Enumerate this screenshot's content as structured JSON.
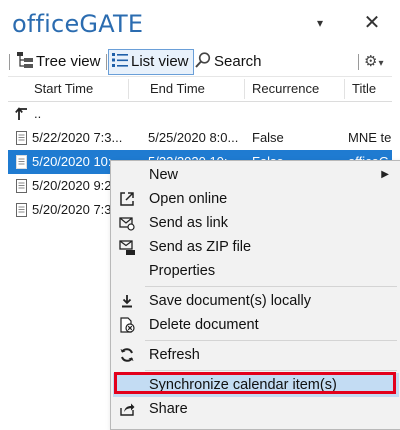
{
  "app": {
    "title": "officeGATE",
    "dropdown_glyph": "▾",
    "close_glyph": "✕"
  },
  "toolbar": {
    "tree_view": "Tree view",
    "list_view": "List view",
    "search": "Search",
    "settings_glyph": "⚙",
    "settings_arrow": "▾"
  },
  "columns": [
    "Start Time",
    "End Time",
    "Recurrence",
    "Title"
  ],
  "rows": [
    {
      "kind": "up",
      "label": ".."
    },
    {
      "start": "5/22/2020 7:3...",
      "end": "5/25/2020 8:0...",
      "recurrence": "False",
      "title": "MNE te"
    },
    {
      "start": "5/20/2020 10:...",
      "end": "5/22/2020 10:...",
      "recurrence": "False",
      "title": "officeG",
      "selected": true
    },
    {
      "start": "5/20/2020 9:2...",
      "end": "",
      "recurrence": "",
      "title": ""
    },
    {
      "start": "5/20/2020 7:3...",
      "end": "",
      "recurrence": "",
      "title": ""
    }
  ],
  "context_menu": {
    "items": [
      {
        "label": "New",
        "icon": "none",
        "submenu": true
      },
      {
        "label": "Open online",
        "icon": "open-external-icon"
      },
      {
        "label": "Send as link",
        "icon": "mail-link-icon"
      },
      {
        "label": "Send as ZIP file",
        "icon": "mail-zip-icon"
      },
      {
        "label": "Properties",
        "icon": "none"
      },
      {
        "label": "Save document(s) locally",
        "icon": "download-icon"
      },
      {
        "label": "Delete document",
        "icon": "delete-document-icon"
      },
      {
        "label": "Refresh",
        "icon": "refresh-icon"
      },
      {
        "label": "Synchronize calendar item(s)",
        "icon": "none",
        "highlighted": true
      },
      {
        "label": "Share",
        "icon": "share-icon"
      }
    ],
    "submenu_arrow": "▶"
  },
  "colors": {
    "title_blue": "#2b6cb0",
    "selection_blue": "#1f7bd1",
    "highlight_red": "#e3001b",
    "hover_blue": "#c3dcf3"
  }
}
